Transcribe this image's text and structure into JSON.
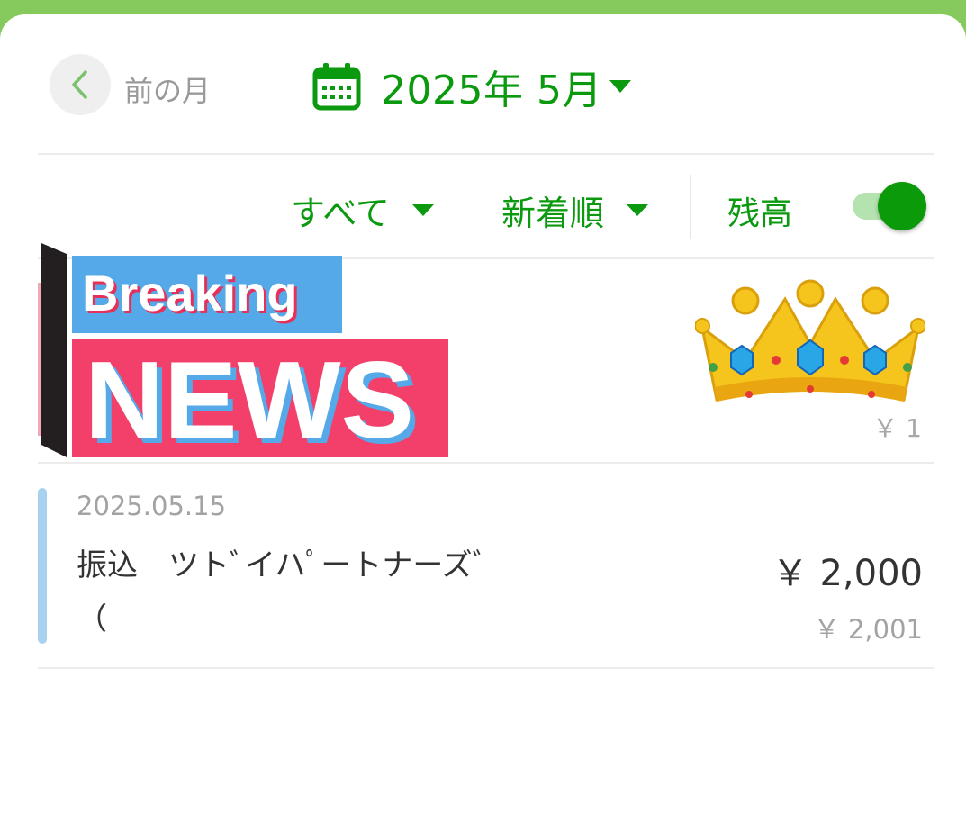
{
  "header": {
    "prev_month_label": "前の月",
    "month_label": "2025年 5月"
  },
  "filters": {
    "category_label": "すべて",
    "sort_label": "新着順",
    "balance_label": "残高",
    "balance_toggle_on": true
  },
  "banner": {
    "breaking_text": "Breaking",
    "news_text": "NEWS",
    "amount": "￥ 1"
  },
  "transactions": [
    {
      "date": "2025.05.15",
      "description": "振込　ツトﾞイハﾟートナーズﾞ（",
      "amount": "￥ 2,000",
      "balance": "￥ 2,001"
    }
  ],
  "colors": {
    "accent": "#0b9a0f",
    "top_bar": "#86c95c",
    "tx_marker": "#a8d0ef"
  }
}
